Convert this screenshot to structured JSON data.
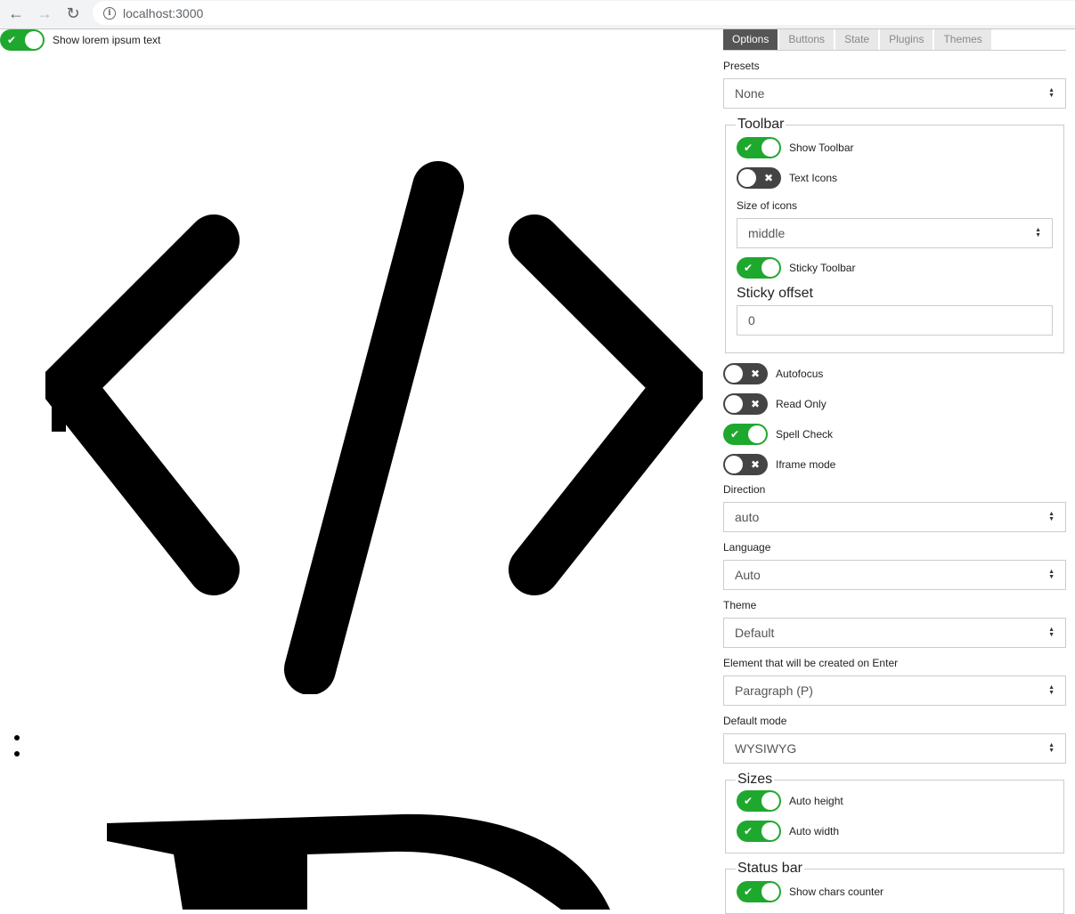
{
  "browser": {
    "back_icon": "arrow-left-icon",
    "forward_icon": "arrow-right-icon",
    "reload_icon": "reload-icon",
    "url": "localhost:3000"
  },
  "editor": {
    "lorem_toggle": {
      "label": "Show lorem ipsum text",
      "on": true
    }
  },
  "panel": {
    "tabs": [
      "Options",
      "Buttons",
      "State",
      "Plugins",
      "Themes"
    ],
    "active_tab": "Options",
    "presets": {
      "label": "Presets",
      "value": "None"
    },
    "toolbar": {
      "legend": "Toolbar",
      "show_toolbar": {
        "label": "Show Toolbar",
        "on": true
      },
      "text_icons": {
        "label": "Text Icons",
        "on": false
      },
      "size_of_icons": {
        "label": "Size of icons",
        "value": "middle"
      },
      "sticky_toolbar": {
        "label": "Sticky Toolbar",
        "on": true
      },
      "sticky_offset": {
        "label": "Sticky offset",
        "value": "0"
      }
    },
    "autofocus": {
      "label": "Autofocus",
      "on": false
    },
    "read_only": {
      "label": "Read Only",
      "on": false
    },
    "spell_check": {
      "label": "Spell Check",
      "on": true
    },
    "iframe_mode": {
      "label": "Iframe mode",
      "on": false
    },
    "direction": {
      "label": "Direction",
      "value": "auto"
    },
    "language": {
      "label": "Language",
      "value": "Auto"
    },
    "theme": {
      "label": "Theme",
      "value": "Default"
    },
    "enter_element": {
      "label": "Element that will be created on Enter",
      "value": "Paragraph (P)"
    },
    "default_mode": {
      "label": "Default mode",
      "value": "WYSIWYG"
    },
    "sizes": {
      "legend": "Sizes",
      "auto_height": {
        "label": "Auto height",
        "on": true
      },
      "auto_width": {
        "label": "Auto width",
        "on": true
      }
    },
    "status_bar": {
      "legend": "Status bar",
      "show_chars_counter": {
        "label": "Show chars counter",
        "on": true
      }
    }
  },
  "colors": {
    "toggle_on": "#1fa82e",
    "toggle_off": "#444444",
    "tab_active": "#555555"
  }
}
